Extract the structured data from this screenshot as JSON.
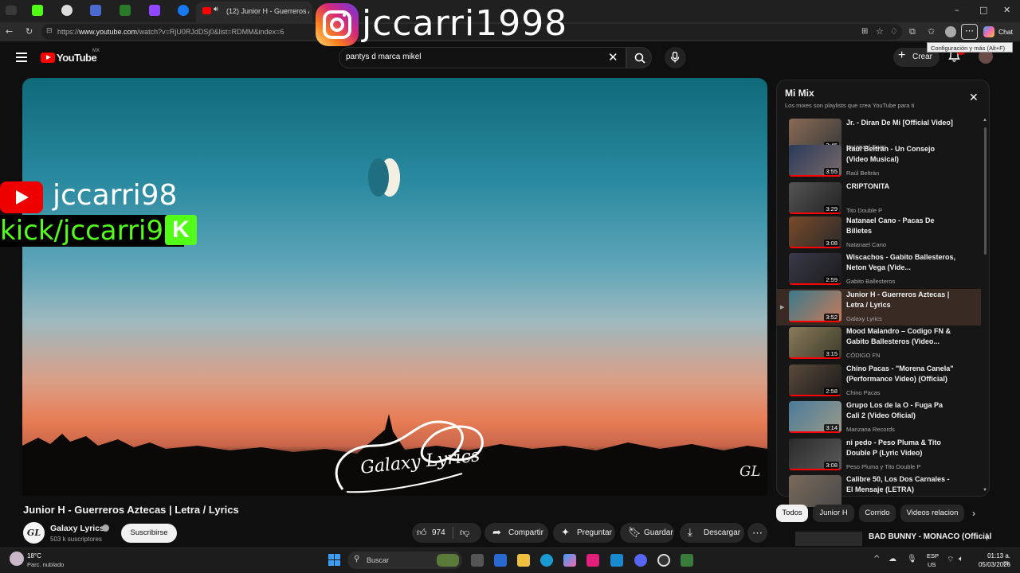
{
  "browser": {
    "active_tab_title": "(12) Junior H - Guerreros Azte",
    "url_prefix": "https://",
    "url_host": "www.youtube.com",
    "url_path": "/watch?v=RjU0RJdDSj0&list=RDMM&index=6",
    "tooltip": "Configuración y más (Alt+F)",
    "copilot_label": "Chat"
  },
  "overlay": {
    "instagram_handle": "jccarri1998",
    "youtube_handle": "jccarri98",
    "kick_handle": "kick/jccarri98",
    "kick_icon_letter": "K"
  },
  "youtube": {
    "logo_text": "YouTube",
    "country": "MX",
    "search_query": "pantys d marca mikel",
    "create_label": "Crear"
  },
  "video": {
    "title": "Junior H - Guerreros Aztecas | Letra / Lyrics",
    "watermark": "GL",
    "logo_text": "Galaxy Lyrics",
    "channel_name": "Galaxy Lyrics",
    "channel_avatar": "GL",
    "subscribers": "503 k suscriptores",
    "subscribe_label": "Suscribirse",
    "likes": "974",
    "share_label": "Compartir",
    "ask_label": "Preguntar",
    "save_label": "Guardar",
    "download_label": "Descargar"
  },
  "playlist": {
    "title": "Mi Mix",
    "subtitle": "Los mixes son playlists que crea YouTube para ti",
    "items": [
      {
        "title": "Jr. - Diran De Mi [Official Video]",
        "channel": "Natanael Cano",
        "duration": "2:45",
        "colors": [
          "#8a6a55",
          "#3a3a3a"
        ]
      },
      {
        "title": "Raúl Beltrán - Un Consejo (Video Musical)",
        "channel": "Raúl Beltrán",
        "duration": "3:55",
        "colors": [
          "#2a3a5a",
          "#7a6a6a"
        ]
      },
      {
        "title": "CRIPTONITA",
        "channel": "Tito Double P",
        "duration": "3:29",
        "colors": [
          "#555555",
          "#222222"
        ]
      },
      {
        "title": "Natanael Cano - Pacas De Billetes",
        "channel": "Natanael Cano",
        "duration": "3:08",
        "colors": [
          "#7a4a2a",
          "#2a2a2a"
        ]
      },
      {
        "title": "Wiscachos - Gabito Ballesteros, Neton Vega (Vide...",
        "channel": "Gabito Ballesteros",
        "duration": "2:59",
        "colors": [
          "#3a3a4a",
          "#1a1a1a"
        ]
      },
      {
        "title": "Junior H - Guerreros Aztecas | Letra / Lyrics",
        "channel": "Galaxy Lyrics",
        "duration": "3:52",
        "colors": [
          "#3a7a8a",
          "#c87a5a"
        ]
      },
      {
        "title": "Mood Malandro – Codigo FN & Gabito Ballesteros (Video...",
        "channel": "CÓDIGO FN",
        "duration": "3:15",
        "colors": [
          "#8a7a5a",
          "#3a3a2a"
        ]
      },
      {
        "title": "Chino Pacas - \"Morena Canela\" (Performance Video) (Official)",
        "channel": "Chino Pacas",
        "duration": "2:58",
        "colors": [
          "#5a4a3a",
          "#1a1a1a"
        ]
      },
      {
        "title": "Grupo Los de la O - Fuga Pa Cali 2 (Video Oficial)",
        "channel": "Manzana Records",
        "duration": "3:14",
        "colors": [
          "#4a7a9a",
          "#9a9a8a"
        ]
      },
      {
        "title": "ni pedo - Peso Pluma & Tito Double P (Lyric Video)",
        "channel": "Peso Pluma y Tito Double P",
        "duration": "3:08",
        "colors": [
          "#2a2a2a",
          "#5a5a5a"
        ]
      },
      {
        "title": "Calibre 50, Los Dos Carnales - El Mensaje (LETRA)",
        "channel": "",
        "duration": "",
        "colors": [
          "#7a6a5a",
          "#4a4a4a"
        ]
      }
    ]
  },
  "chips": [
    "Todos",
    "Junior H",
    "Corrido",
    "Videos relacion"
  ],
  "related": {
    "title": "BAD BUNNY - MONACO (Official"
  },
  "taskbar": {
    "temp": "18°C",
    "weather": "Parc. nublado",
    "search_placeholder": "Buscar",
    "lang1": "ESP",
    "lang2": "US",
    "time": "01:13 a. m.",
    "date": "05/03/2026"
  }
}
